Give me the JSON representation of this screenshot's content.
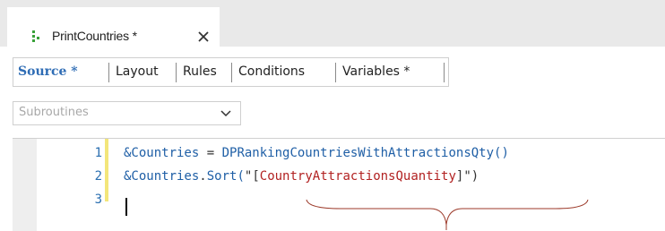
{
  "tab": {
    "title": "PrintCountries *",
    "icon": "object-icon",
    "close_icon": "close-icon"
  },
  "subtabs": [
    {
      "label": "Source *",
      "active": true
    },
    {
      "label": "Layout",
      "active": false
    },
    {
      "label": "Rules",
      "active": false
    },
    {
      "label": "Conditions",
      "active": false
    },
    {
      "label": "Variables *",
      "active": false
    }
  ],
  "dropdown": {
    "value": "Subroutines",
    "icon": "chevron-down-icon"
  },
  "editor": {
    "line_numbers": [
      "1",
      "2",
      "3"
    ],
    "lines": [
      {
        "var": "&Countries",
        "op": " = ",
        "rest": "DPRankingCountriesWithAttractionsQty()"
      },
      {
        "var": "&Countries",
        "op": ".",
        "fn": "Sort(",
        "q1": "\"",
        "lb": "[",
        "str": "CountryAttractionsQuantity",
        "rb": "]",
        "q2": "\"",
        "close": ")"
      }
    ]
  },
  "colors": {
    "accent": "#2f6db5",
    "string": "#b22222",
    "change_bar": "#f3e67a"
  }
}
